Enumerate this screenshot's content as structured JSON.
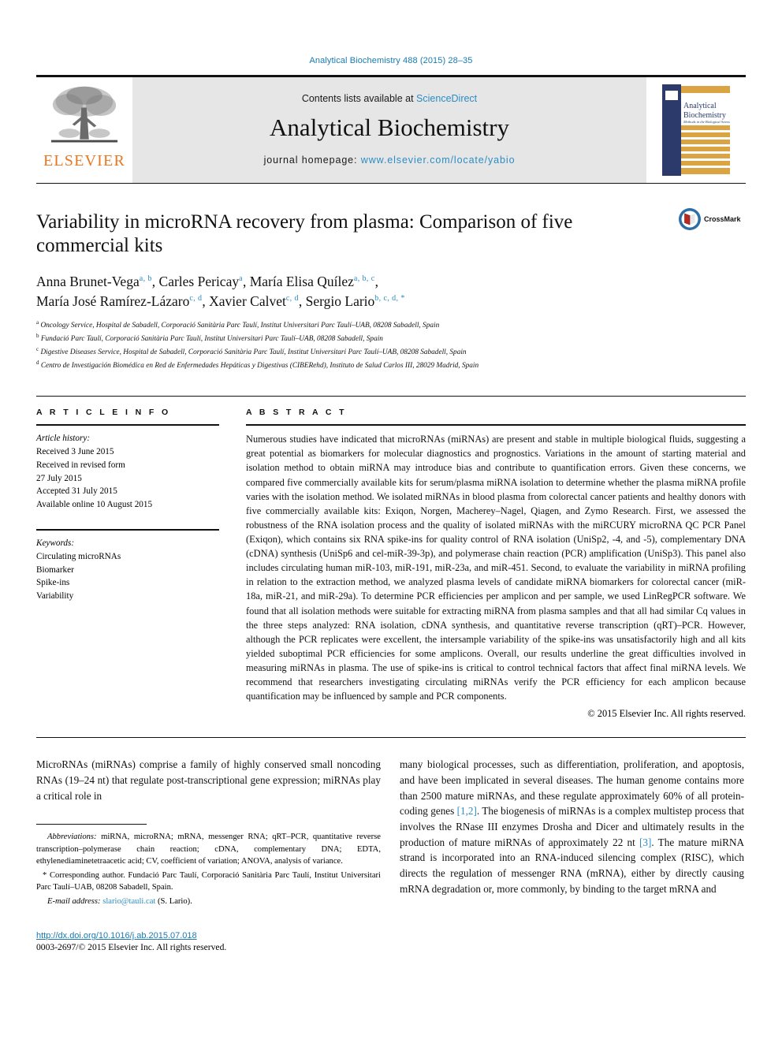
{
  "running_head": "Analytical Biochemistry 488 (2015) 28–35",
  "masthead": {
    "contents_text": "Contents lists available at",
    "sciencedirect": "ScienceDirect",
    "journal_name": "Analytical Biochemistry",
    "homepage_label": "journal homepage:",
    "homepage_url": "www.elsevier.com/locate/yabio",
    "publisher_logo_text": "ELSEVIER",
    "cover_title_line1": "Analytical",
    "cover_title_line2": "Biochemistry",
    "cover_subtitle": "Methods in the Biological Sciences"
  },
  "colors": {
    "link_blue": "#2b8dc4",
    "header_blue": "#1a7ab0",
    "elsevier_orange": "#E87722",
    "masthead_gray": "#e6e6e6",
    "cover_navy": "#2b3a6b",
    "cover_gold": "#d9a441"
  },
  "article": {
    "title": "Variability in microRNA recovery from plasma: Comparison of five commercial kits",
    "crossmark_label": "CrossMark",
    "authors_line1": [
      {
        "name": "Anna Brunet-Vega",
        "sup": "a, b",
        "sep": ", "
      },
      {
        "name": "Carles Pericay",
        "sup": "a",
        "sep": ", "
      },
      {
        "name": "María Elisa Quílez",
        "sup": "a, b, c",
        "sep": ","
      }
    ],
    "authors_line2": [
      {
        "name": "María José Ramírez-Lázaro",
        "sup": "c, d",
        "sep": ", "
      },
      {
        "name": "Xavier Calvet",
        "sup": "c, d",
        "sep": ", "
      },
      {
        "name": "Sergio Lario",
        "sup": "b, c, d, *",
        "sep": ""
      }
    ],
    "affiliations": [
      {
        "mark": "a",
        "text": "Oncology Service, Hospital de Sabadell, Corporació Sanitària Parc Taulí, Institut Universitari Parc Taulí–UAB, 08208 Sabadell, Spain"
      },
      {
        "mark": "b",
        "text": "Fundació Parc Taulí, Corporació Sanitària Parc Taulí, Institut Universitari Parc Taulí–UAB, 08208 Sabadell, Spain"
      },
      {
        "mark": "c",
        "text": "Digestive Diseases Service, Hospital de Sabadell, Corporació Sanitària Parc Taulí, Institut Universitari Parc Taulí–UAB, 08208 Sabadell, Spain"
      },
      {
        "mark": "d",
        "text": "Centro de Investigación Biomédica en Red de Enfermedades Hepáticas y Digestivas (CIBERehd), Instituto de Salud Carlos III, 28029 Madrid, Spain"
      }
    ]
  },
  "article_info": {
    "heading": "A R T I C L E   I N F O",
    "history_label": "Article history:",
    "history": [
      "Received 3 June 2015",
      "Received in revised form",
      "27 July 2015",
      "Accepted 31 July 2015",
      "Available online 10 August 2015"
    ],
    "keywords_label": "Keywords:",
    "keywords": [
      "Circulating microRNAs",
      "Biomarker",
      "Spike-ins",
      "Variability"
    ]
  },
  "abstract": {
    "heading": "A B S T R A C T",
    "text": "Numerous studies have indicated that microRNAs (miRNAs) are present and stable in multiple biological fluids, suggesting a great potential as biomarkers for molecular diagnostics and prognostics. Variations in the amount of starting material and isolation method to obtain miRNA may introduce bias and contribute to quantification errors. Given these concerns, we compared five commercially available kits for serum/plasma miRNA isolation to determine whether the plasma miRNA profile varies with the isolation method. We isolated miRNAs in blood plasma from colorectal cancer patients and healthy donors with five commercially available kits: Exiqon, Norgen, Macherey–Nagel, Qiagen, and Zymo Research. First, we assessed the robustness of the RNA isolation process and the quality of isolated miRNAs with the miRCURY microRNA QC PCR Panel (Exiqon), which contains six RNA spike-ins for quality control of RNA isolation (UniSp2, -4, and -5), complementary DNA (cDNA) synthesis (UniSp6 and cel-miR-39-3p), and polymerase chain reaction (PCR) amplification (UniSp3). This panel also includes circulating human miR-103, miR-191, miR-23a, and miR-451. Second, to evaluate the variability in miRNA profiling in relation to the extraction method, we analyzed plasma levels of candidate miRNA biomarkers for colorectal cancer (miR-18a, miR-21, and miR-29a). To determine PCR efficiencies per amplicon and per sample, we used LinRegPCR software. We found that all isolation methods were suitable for extracting miRNA from plasma samples and that all had similar Cq values in the three steps analyzed: RNA isolation, cDNA synthesis, and quantitative reverse transcription (qRT)–PCR. However, although the PCR replicates were excellent, the intersample variability of the spike-ins was unsatisfactorily high and all kits yielded suboptimal PCR efficiencies for some amplicons. Overall, our results underline the great difficulties involved in measuring miRNAs in plasma. The use of spike-ins is critical to control technical factors that affect final miRNA levels. We recommend that researchers investigating circulating miRNAs verify the PCR efficiency for each amplicon because quantification may be influenced by sample and PCR components.",
    "copyright": "© 2015 Elsevier Inc. All rights reserved."
  },
  "body": {
    "left_paragraph": "MicroRNAs (miRNAs) comprise a family of highly conserved small noncoding RNAs (19–24 nt) that regulate post-transcriptional gene expression; miRNAs play a critical role in",
    "right_part1": "many biological processes, such as differentiation, proliferation, and apoptosis, and have been implicated in several diseases. The human genome contains more than 2500 mature miRNAs, and these regulate approximately 60% of all protein-coding genes ",
    "right_cite1": "[1,2]",
    "right_part2": ". The biogenesis of miRNAs is a complex multistep process that involves the RNase III enzymes Drosha and Dicer and ultimately results in the production of mature miRNAs of approximately 22 nt ",
    "right_cite2": "[3]",
    "right_part3": ". The mature miRNA strand is incorporated into an RNA-induced silencing complex (RISC), which directs the regulation of messenger RNA (mRNA), either by directly causing mRNA degradation or, more commonly, by binding to the target mRNA and"
  },
  "footnotes": {
    "abbrev_label": "Abbreviations:",
    "abbrev_text": " miRNA, microRNA; mRNA, messenger RNA; qRT–PCR, quantitative reverse transcription–polymerase chain reaction; cDNA, complementary DNA; EDTA, ethylenediaminetetraacetic acid; CV, coefficient of variation; ANOVA, analysis of variance.",
    "corresponding": "* Corresponding author. Fundació Parc Taulí, Corporació Sanitària Parc Taulí, Institut Universitari Parc Taulí–UAB, 08208 Sabadell, Spain.",
    "email_label": "E-mail address:",
    "email": "slario@tauli.cat",
    "email_suffix": " (S. Lario)."
  },
  "footer": {
    "doi": "http://dx.doi.org/10.1016/j.ab.2015.07.018",
    "issn_copyright": "0003-2697/© 2015 Elsevier Inc. All rights reserved."
  }
}
